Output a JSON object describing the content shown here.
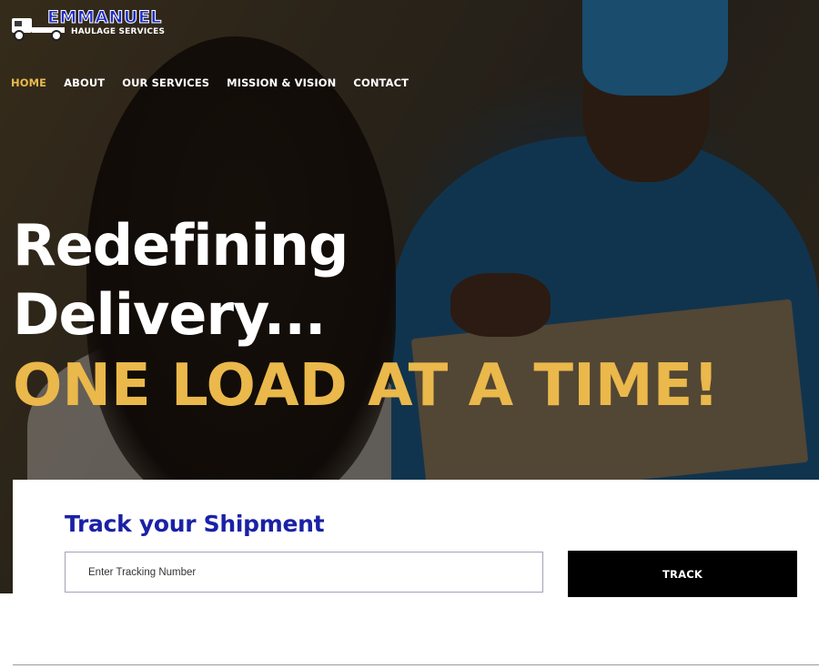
{
  "brand": {
    "name": "EMMANUEL",
    "tagline": "HAULAGE SERVICES",
    "primary_color": "#1f2cc9",
    "accent_color": "#e9b94c"
  },
  "nav": {
    "items": [
      {
        "label": "HOME",
        "active": true
      },
      {
        "label": "ABOUT",
        "active": false
      },
      {
        "label": "OUR SERVICES",
        "active": false
      },
      {
        "label": "MISSION & VISION",
        "active": false
      },
      {
        "label": "CONTACT",
        "active": false
      }
    ]
  },
  "hero": {
    "line1": "Redefining",
    "line2": "Delivery...",
    "line3": "ONE LOAD AT A TIME!"
  },
  "tracking": {
    "title": "Track your Shipment",
    "input_placeholder": "Enter Tracking Number",
    "input_value": "",
    "button_label": "TRACK",
    "title_color": "#1a21a6"
  }
}
